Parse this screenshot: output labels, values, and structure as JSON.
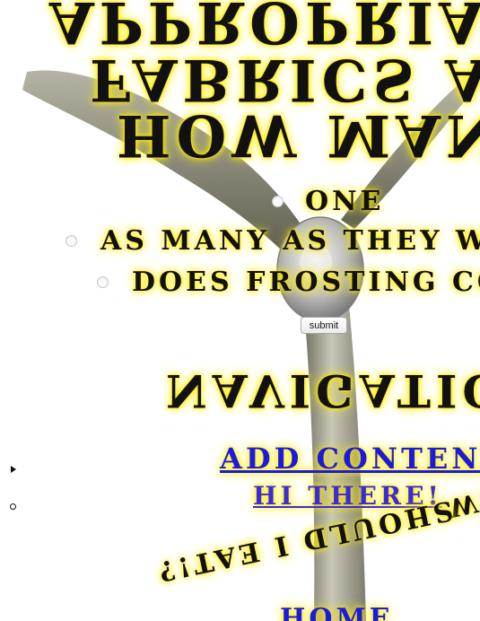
{
  "heading": {
    "line1": "Appropriate for",
    "line2": "Fabrics are",
    "line3": "How many"
  },
  "poll": {
    "options": [
      {
        "label": "one"
      },
      {
        "label": "as many as they want"
      },
      {
        "label": "does frosting count?"
      }
    ],
    "submit_label": "submit"
  },
  "nav": {
    "title": "Navigation",
    "links": [
      {
        "label": "add content"
      },
      {
        "label": "hi there!"
      }
    ],
    "slanted_top": "what",
    "slanted_bottom": "should i eat!?",
    "home_label": "home"
  },
  "colors": {
    "glow": "#ffe600",
    "link": "#1a1ae0",
    "propeller": "#9a9a86"
  }
}
